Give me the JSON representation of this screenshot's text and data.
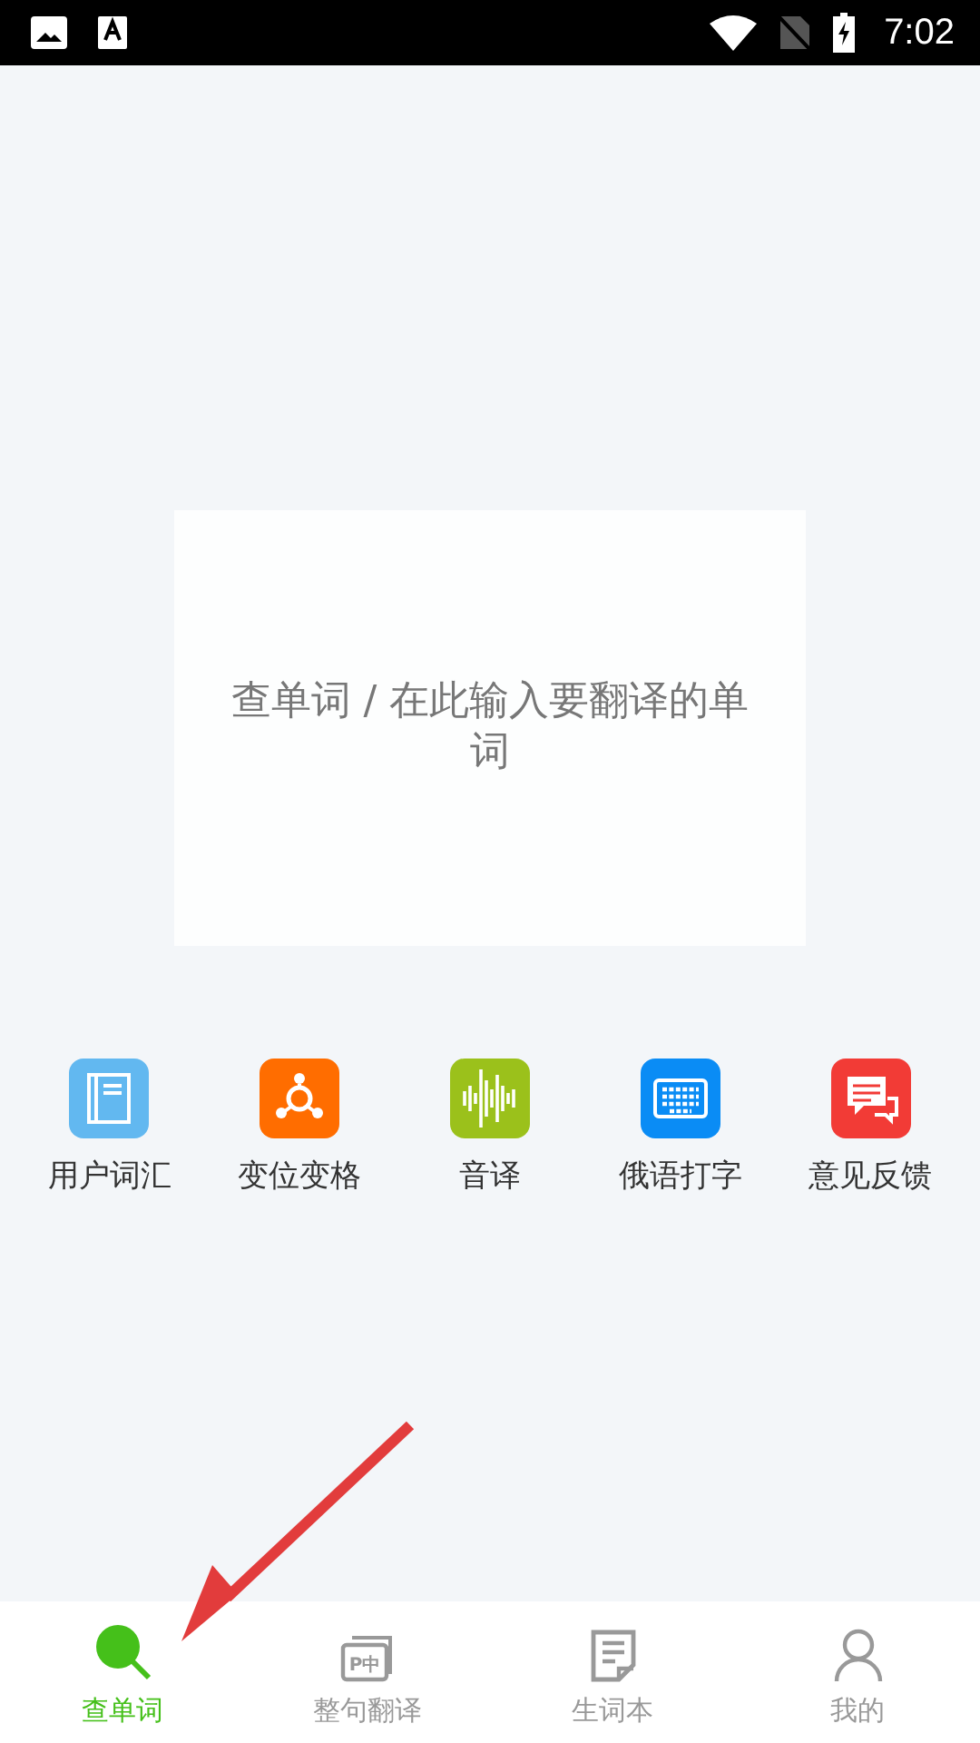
{
  "status_bar": {
    "time": "7:02"
  },
  "search": {
    "placeholder": "查单词 / 在此输入要翻译的单词"
  },
  "features": [
    {
      "label": "用户词汇",
      "kind": "book",
      "color": "#62b8f0"
    },
    {
      "label": "变位变格",
      "kind": "network",
      "color": "#ff6d00"
    },
    {
      "label": "音译",
      "kind": "wave",
      "color": "#9bc11b"
    },
    {
      "label": "俄语打字",
      "kind": "keyboard",
      "color": "#0a8cf5"
    },
    {
      "label": "意见反馈",
      "kind": "chat",
      "color": "#f23b36"
    }
  ],
  "bottom_nav": [
    {
      "label": "查单词",
      "kind": "search",
      "selected": true
    },
    {
      "label": "整句翻译",
      "kind": "translate",
      "icon_text": "P中",
      "selected": false
    },
    {
      "label": "生词本",
      "kind": "notebook",
      "selected": false
    },
    {
      "label": "我的",
      "kind": "person",
      "selected": false
    }
  ]
}
